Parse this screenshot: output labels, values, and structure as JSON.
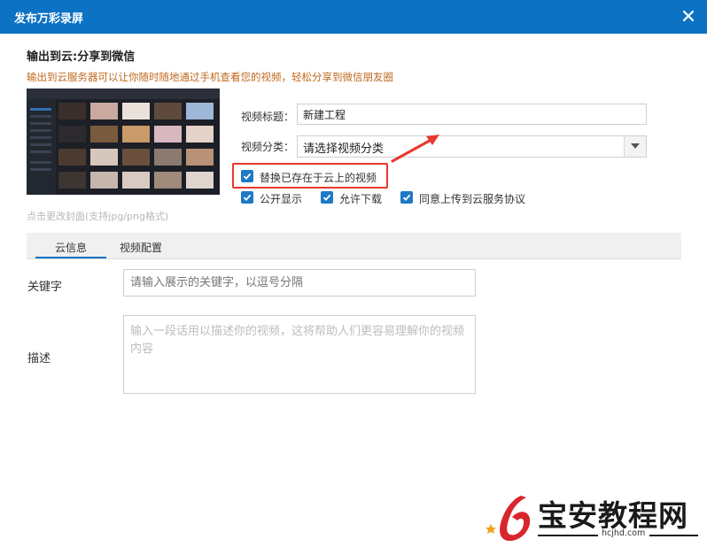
{
  "dialog": {
    "title": "发布万彩录屏"
  },
  "cloud_output": {
    "heading": "输出到云:分享到微信",
    "description": "输出到云服务器可以让你随时随地通过手机查看您的视频，轻松分享到微信朋友圈",
    "thumbnail_hint": "点击更改封面(支持jpg/png格式)"
  },
  "form": {
    "title_label": "视频标题：",
    "title_value": "新建工程",
    "category_label": "视频分类：",
    "category_value": "请选择视频分类"
  },
  "options": {
    "replace_existing": {
      "label": "替换已存在于云上的视频",
      "checked": true
    },
    "public": {
      "label": "公开显示",
      "checked": true
    },
    "allow_download": {
      "label": "允许下载",
      "checked": true
    },
    "agree_terms": {
      "label": "同意上传到云服务协议",
      "checked": true
    }
  },
  "tabs": [
    {
      "label": "云信息",
      "active": true
    },
    {
      "label": "视频配置",
      "active": false
    }
  ],
  "cloud_info": {
    "keyword_label": "关键字",
    "keyword_placeholder": "请输入展示的关键字，以逗号分隔",
    "description_label": "描述",
    "description_placeholder": "输入一段话用以描述你的视频，这将帮助人们更容易理解你的视频内容"
  },
  "watermark": {
    "name": "宝安教程网",
    "url": "hcjhd.com"
  },
  "colors": {
    "title_bar": "#0b72c4",
    "checkbox": "#1d79c4",
    "highlight": "#e8392f",
    "description_text": "#c0681d"
  }
}
